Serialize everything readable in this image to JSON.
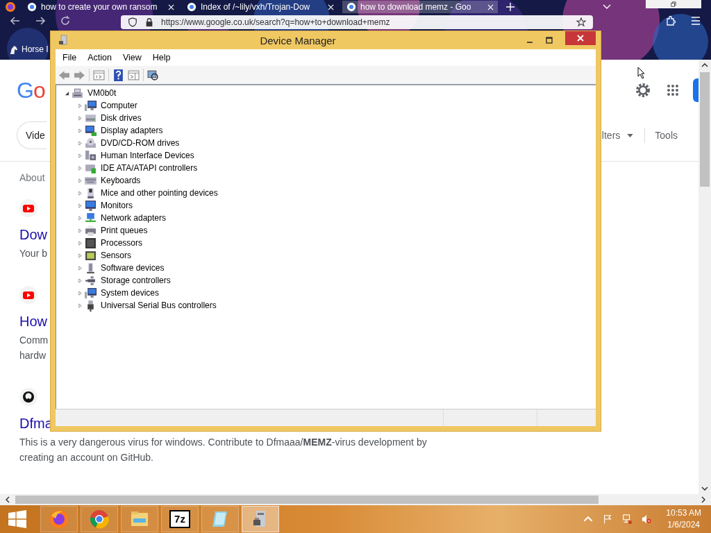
{
  "browser": {
    "tabs": [
      {
        "title": "how to create your own ransom",
        "selected": false
      },
      {
        "title": "Index of /~lily/vxh/Trojan-Dow",
        "selected": false
      },
      {
        "title": "how to download memz - Goo",
        "selected": true
      }
    ],
    "url": "https://www.google.co.uk/search?q=how+to+download+memz",
    "bookmarks": [
      "Horse I"
    ]
  },
  "page": {
    "logo": "Go",
    "chips": [
      "Vide"
    ],
    "filters": "lters",
    "tools": "Tools",
    "result_stats": "About",
    "results": [
      {
        "kind": "youtube",
        "title": "Dow",
        "snippet_lines": [
          "Your b"
        ]
      },
      {
        "kind": "youtube",
        "title": "How",
        "snippet_lines": [
          "Comm",
          "hardw"
        ]
      },
      {
        "kind": "github",
        "title": "Dfma",
        "snippet": "This is a very dangerous virus for windows. Contribute to Dfmaaa/**MEMZ**-virus development by creating an account on GitHub."
      }
    ]
  },
  "device_manager": {
    "title": "Device Manager",
    "menu": [
      "File",
      "Action",
      "View",
      "Help"
    ],
    "tree": {
      "label": "VM0b0t",
      "expanded": true,
      "children": [
        {
          "label": "Computer",
          "kind": "computer",
          "expanded": false
        },
        {
          "label": "Disk drives",
          "kind": "drive",
          "expanded": false
        },
        {
          "label": "Display adapters",
          "kind": "display",
          "expanded": false
        },
        {
          "label": "DVD/CD-ROM drives",
          "kind": "disc",
          "expanded": false
        },
        {
          "label": "Human Interface Devices",
          "kind": "hid",
          "expanded": false
        },
        {
          "label": "IDE ATA/ATAPI controllers",
          "kind": "controller",
          "expanded": false
        },
        {
          "label": "Keyboards",
          "kind": "keyboard",
          "expanded": false
        },
        {
          "label": "Mice and other pointing devices",
          "kind": "mouse",
          "expanded": false
        },
        {
          "label": "Monitors",
          "kind": "monitor",
          "expanded": false
        },
        {
          "label": "Network adapters",
          "kind": "network",
          "expanded": false
        },
        {
          "label": "Print queues",
          "kind": "printer",
          "expanded": false
        },
        {
          "label": "Processors",
          "kind": "chip",
          "expanded": false
        },
        {
          "label": "Sensors",
          "kind": "sensor",
          "expanded": false
        },
        {
          "label": "Software devices",
          "kind": "software",
          "expanded": false
        },
        {
          "label": "Storage controllers",
          "kind": "storage",
          "expanded": false
        },
        {
          "label": "System devices",
          "kind": "computer",
          "expanded": false
        },
        {
          "label": "Universal Serial Bus controllers",
          "kind": "usb",
          "expanded": false
        }
      ]
    }
  },
  "taskbar": {
    "items": [
      {
        "kind": "firefox",
        "selected": false
      },
      {
        "kind": "chrome",
        "selected": false
      },
      {
        "kind": "explorer",
        "selected": false
      },
      {
        "kind": "archiver",
        "label": "7z",
        "selected": false
      },
      {
        "kind": "notepad",
        "selected": false
      },
      {
        "kind": "devmgr",
        "selected": true
      }
    ],
    "time": "10:53 AM",
    "date": "1/6/2024"
  }
}
